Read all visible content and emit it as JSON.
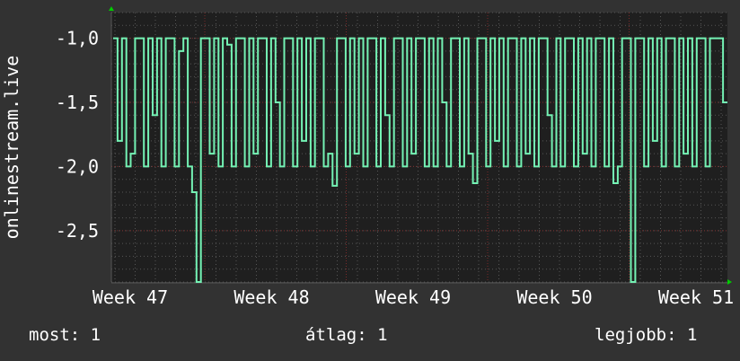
{
  "chart_data": {
    "type": "line",
    "ylabel": "onlinestream.live",
    "ylim": [
      -2.9,
      -0.8
    ],
    "yticks": [
      -1.0,
      -1.5,
      -2.0,
      -2.5
    ],
    "ytick_labels": [
      "-1,0",
      "-1,5",
      "-2,0",
      "-2,5"
    ],
    "xtick_labels": [
      "Week 47",
      "Week 48",
      "Week 49",
      "Week 50",
      "Week 51"
    ],
    "grid": true,
    "colors": {
      "background": "#323232",
      "plot": "#1f1f1f",
      "line": "#74f2b4",
      "major_grid": "#7a2a2a",
      "minor_grid": "#555555",
      "arrow": "#00cc00"
    },
    "series": [
      {
        "values": [
          -1,
          -1.8,
          -1,
          -2,
          -1.9,
          -1,
          -1,
          -2,
          -1,
          -1.6,
          -1,
          -2,
          -1,
          -1,
          -2,
          -1.1,
          -1,
          -2,
          -2.2,
          -2.9,
          -1,
          -1,
          -1.9,
          -1,
          -2,
          -1,
          -1.05,
          -2,
          -1,
          -1,
          -2,
          -1,
          -1.9,
          -1,
          -1,
          -2,
          -1,
          -1.5,
          -2,
          -1,
          -1,
          -2,
          -1,
          -1.8,
          -1,
          -2,
          -1,
          -1,
          -2,
          -1.9,
          -2.15,
          -1,
          -1,
          -2,
          -1,
          -1.9,
          -1,
          -2,
          -1,
          -1,
          -2,
          -1,
          -1.6,
          -2,
          -1,
          -1,
          -2,
          -1,
          -1.9,
          -1,
          -1,
          -2,
          -1,
          -2,
          -1,
          -1.5,
          -2,
          -1,
          -1,
          -2,
          -1,
          -1.9,
          -2.13,
          -1,
          -1,
          -2,
          -1,
          -1.8,
          -1,
          -2,
          -1,
          -1,
          -2,
          -1,
          -1.9,
          -1,
          -2,
          -1,
          -1,
          -1.6,
          -2,
          -1,
          -2,
          -1,
          -1,
          -2,
          -1,
          -1.9,
          -1,
          -2,
          -1,
          -1,
          -2,
          -1,
          -2.13,
          -2,
          -1,
          -1,
          -2.9,
          -1,
          -1,
          -2,
          -1,
          -1.8,
          -1,
          -2,
          -1,
          -1,
          -2,
          -1,
          -1.9,
          -1,
          -2,
          -1,
          -1,
          -2,
          -1,
          -1,
          -1,
          -1.5
        ]
      }
    ]
  },
  "legend": {
    "current": "most: 1",
    "average": "átlag: 1",
    "maximum": "legjobb: 1"
  }
}
